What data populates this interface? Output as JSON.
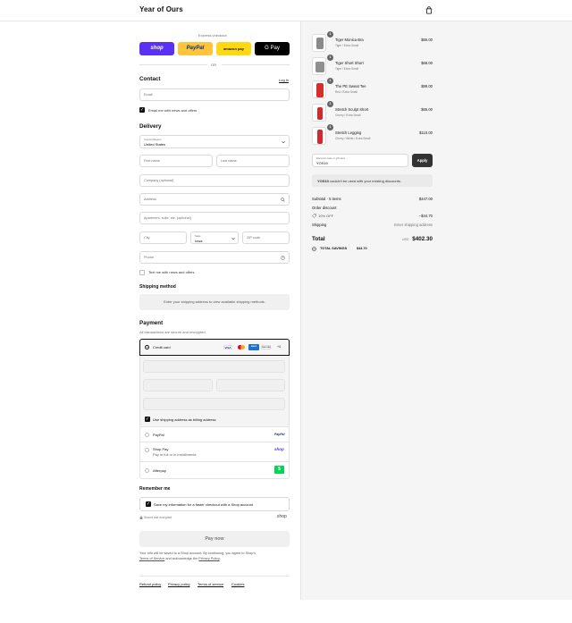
{
  "header": {
    "store_name": "Year of Ours"
  },
  "express": {
    "title": "Express checkout",
    "buttons": [
      {
        "label": "shop",
        "bg": "#5a31f4",
        "fg": "#ffffff"
      },
      {
        "label": "PayPal",
        "bg": "#ffc439",
        "fg": "#003087"
      },
      {
        "label": "amazon pay",
        "bg": "#ffd814",
        "fg": "#111111"
      },
      {
        "label": "G Pay",
        "bg": "#000000",
        "fg": "#ffffff"
      }
    ],
    "or": "OR"
  },
  "contact": {
    "title": "Contact",
    "login": "Log in",
    "email_placeholder": "Email",
    "news_label": "Email me with news and offers"
  },
  "delivery": {
    "title": "Delivery",
    "country_label": "Country/Region",
    "country_value": "United States",
    "first_name": "First name",
    "last_name": "Last name",
    "company": "Company (optional)",
    "address": "Address",
    "apartment": "Apartment, suite, etc. (optional)",
    "city": "City",
    "state_label": "State",
    "state_value": "Iowa",
    "zip": "ZIP code",
    "phone": "Phone",
    "sms_label": "Text me with news and offers"
  },
  "shipping_method": {
    "title": "Shipping method",
    "message": "Enter your shipping address to view available shipping methods."
  },
  "payment": {
    "title": "Payment",
    "subtitle": "All transactions are secure and encrypted.",
    "credit_card": "Credit card",
    "card_more": "+4",
    "card_brands": [
      "VISA",
      "MC",
      "AMEX",
      "DISCOVER"
    ],
    "billing_label": "Use shipping address as billing address",
    "paypal": "PayPal",
    "paypal_logo": "PayPal",
    "shoppay": "Shop Pay",
    "shoppay_sub": "Pay in full or in installments",
    "shoppay_logo": "shop",
    "afterpay": "Afterpay",
    "afterpay_logo": "$"
  },
  "remember": {
    "title": "Remember me",
    "save_label": "Save my information for a faster checkout with a Shop account",
    "secure": "Secure and encrypted",
    "shop_logo": "shop"
  },
  "pay_now": "Pay now",
  "legal": {
    "line1": "Your info will be saved to a Shop account. By continuing, you agree to Shop's",
    "terms": "Terms of Service",
    "and": "and acknowledge the",
    "privacy": "Privacy Policy",
    "period": "."
  },
  "footer": {
    "links": [
      "Refund policy",
      "Privacy policy",
      "Terms of service",
      "Cookies"
    ]
  },
  "cart": {
    "items": [
      {
        "name": "Tiger Monica Bra",
        "variant": "Tiger / Extra Small",
        "price": "$65.00",
        "qty": "1",
        "color": "#8a8a8a"
      },
      {
        "name": "Tiger Short Short",
        "variant": "Tiger / Extra Small",
        "price": "$68.00",
        "qty": "1",
        "color": "#8f8f8f"
      },
      {
        "name": "The PE Sweat Tee",
        "variant": "Red / Extra Small",
        "price": "$99.00",
        "qty": "1",
        "color": "#d82d2d"
      },
      {
        "name": "Stretch Sculpt Short",
        "variant": "Cherry / Extra Small",
        "price": "$65.00",
        "qty": "1",
        "color": "#d4282c"
      },
      {
        "name": "Stretch Legging",
        "variant": "Cherry / White / Extra Small",
        "price": "$110.00",
        "qty": "1",
        "color": "#d4282c"
      }
    ],
    "discount_label": "Discount code or gift card",
    "discount_value": "YOS10",
    "apply": "Apply",
    "discount_error_code": "YOS10",
    "discount_error_msg": "couldn't be used with your existing discounts.",
    "subtotal_label": "Subtotal · 5 items",
    "subtotal": "$447.00",
    "order_discount_label": "Order discount",
    "discount_tag": "10% OFF",
    "discount_amount": "−$44.70",
    "shipping_label": "Shipping",
    "shipping_value": "Enter shipping address",
    "total_label": "Total",
    "currency": "USD",
    "total": "$402.30",
    "savings_label": "TOTAL SAVINGS",
    "savings": "$44.70"
  }
}
